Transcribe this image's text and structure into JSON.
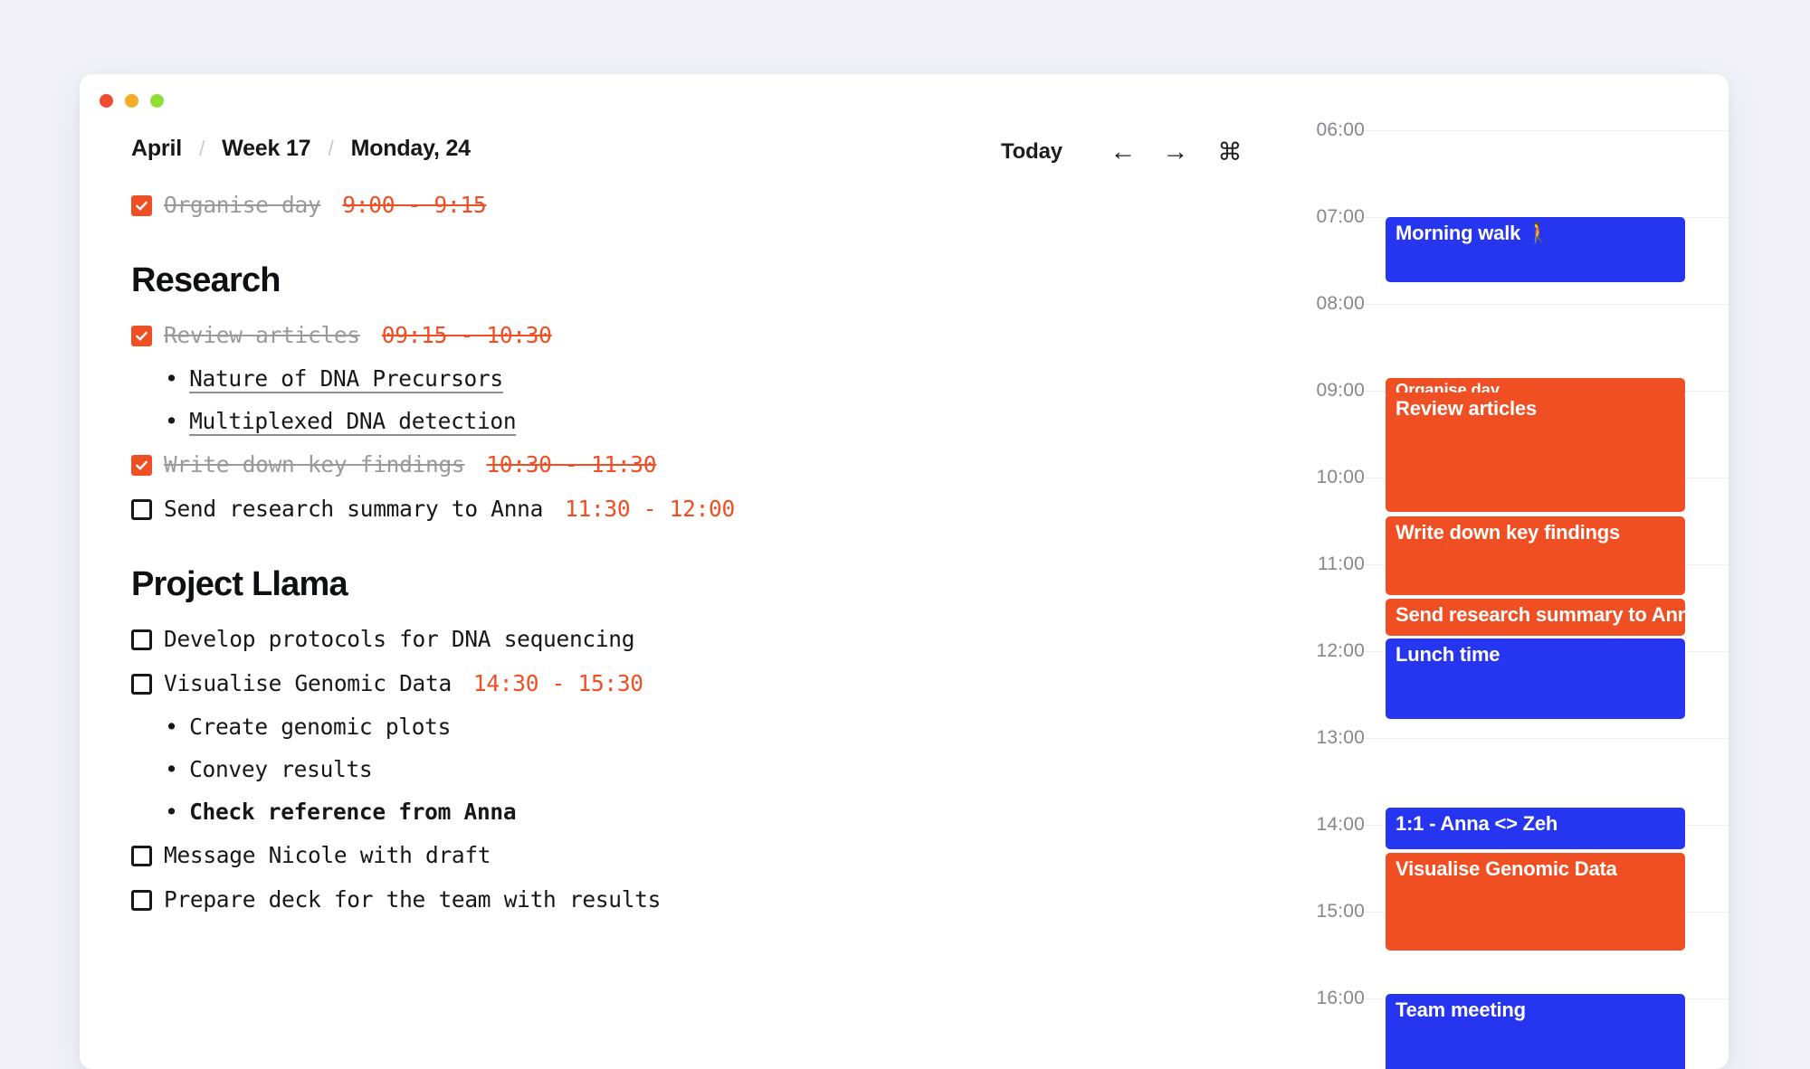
{
  "window": {
    "traffic_lights": [
      {
        "name": "close",
        "color": "#ef4b33"
      },
      {
        "name": "minimize",
        "color": "#f5ac26"
      },
      {
        "name": "maximize",
        "color": "#8fdd35"
      }
    ]
  },
  "header": {
    "breadcrumb": [
      {
        "label": "April"
      },
      {
        "label": "Week 17"
      },
      {
        "label": "Monday, 24"
      }
    ],
    "separator": "/",
    "toolbar": {
      "today_label": "Today",
      "prev_icon": "←",
      "next_icon": "→",
      "command_icon": "⌘"
    }
  },
  "tasks": {
    "top_items": [
      {
        "label": "Organise day",
        "time": "9:00 - 9:15",
        "checked": true
      }
    ],
    "sections": [
      {
        "title": "Research",
        "items": [
          {
            "label": "Review articles",
            "time": "09:15 - 10:30",
            "checked": true,
            "subitems": [
              {
                "text": "Nature of DNA Precursors",
                "style": "link"
              },
              {
                "text": "Multiplexed DNA detection",
                "style": "link"
              }
            ]
          },
          {
            "label": "Write down key findings",
            "time": "10:30 - 11:30",
            "checked": true,
            "subitems": []
          },
          {
            "label": "Send research summary to Anna",
            "time": "11:30 - 12:00",
            "checked": false,
            "subitems": []
          }
        ]
      },
      {
        "title": "Project Llama",
        "items": [
          {
            "label": "Develop protocols for DNA sequencing",
            "time": "",
            "checked": false,
            "subitems": []
          },
          {
            "label": "Visualise Genomic Data",
            "time": "14:30 - 15:30",
            "checked": false,
            "subitems": [
              {
                "text": "Create genomic plots",
                "style": "plain"
              },
              {
                "text": "Convey results",
                "style": "plain"
              },
              {
                "text": "Check reference from Anna",
                "style": "bold"
              }
            ]
          },
          {
            "label": "Message Nicole with draft",
            "time": "",
            "checked": false,
            "subitems": []
          },
          {
            "label": "Prepare deck for the team with results",
            "time": "",
            "checked": false,
            "subitems": []
          }
        ]
      }
    ],
    "bullet_glyph": "•"
  },
  "calendar": {
    "colors": {
      "task_event": "#f04e23",
      "calendar_event": "#2635f0"
    },
    "hours": [
      "06:00",
      "07:00",
      "08:00",
      "09:00",
      "10:00",
      "11:00",
      "12:00",
      "13:00",
      "14:00",
      "15:00",
      "16:00"
    ],
    "events": [
      {
        "title": "Morning walk 🚶",
        "start": 7.0,
        "end": 7.75,
        "type": "calendar_event",
        "size": "normal"
      },
      {
        "title": "Organise day",
        "start": 8.85,
        "end": 9.0,
        "type": "task_event",
        "size": "small"
      },
      {
        "title": "Review articles",
        "start": 9.02,
        "end": 10.4,
        "type": "task_event",
        "size": "normal"
      },
      {
        "title": "Write down key findings",
        "start": 10.45,
        "end": 11.35,
        "type": "task_event",
        "size": "normal"
      },
      {
        "title": "Send research summary to Anna",
        "start": 11.4,
        "end": 11.82,
        "type": "task_event",
        "size": "normal"
      },
      {
        "title": "Lunch time",
        "start": 11.85,
        "end": 12.78,
        "type": "calendar_event",
        "size": "normal"
      },
      {
        "title": "1:1 - Anna <> Zeh",
        "start": 13.8,
        "end": 14.28,
        "type": "calendar_event",
        "size": "normal"
      },
      {
        "title": "Visualise Genomic Data",
        "start": 14.32,
        "end": 15.45,
        "type": "task_event",
        "size": "normal"
      },
      {
        "title": "Team meeting",
        "start": 15.95,
        "end": 16.9,
        "type": "calendar_event",
        "size": "normal"
      }
    ]
  }
}
